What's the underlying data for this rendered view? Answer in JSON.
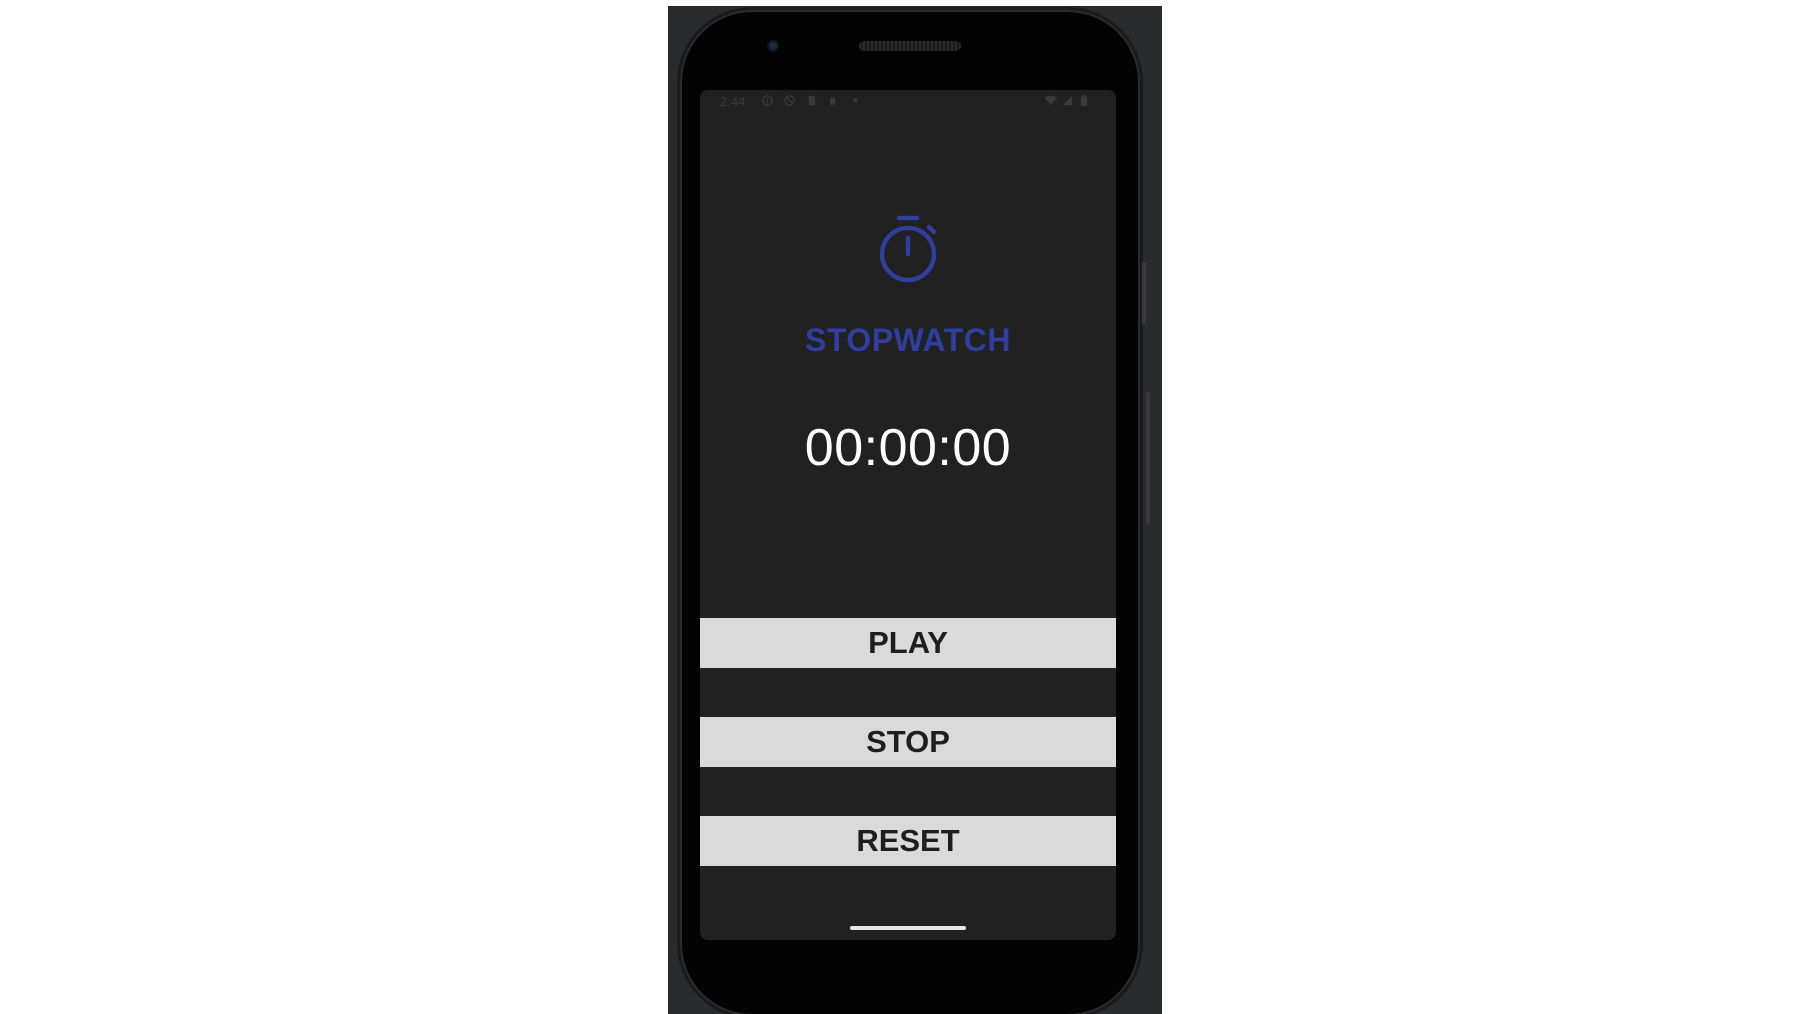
{
  "status_bar": {
    "time": "2:44",
    "left_icons": [
      "info-icon",
      "blocked-icon",
      "sim-card-icon",
      "hand-icon",
      "dot-icon"
    ],
    "right_icons": [
      "wifi-icon",
      "signal-icon",
      "battery-icon"
    ]
  },
  "app": {
    "icon": "stopwatch-icon",
    "title": "STOPWATCH",
    "timer": "00:00:00",
    "accent_color": "#2f3e9f"
  },
  "buttons": {
    "play": "PLAY",
    "stop": "STOP",
    "reset": "RESET"
  }
}
